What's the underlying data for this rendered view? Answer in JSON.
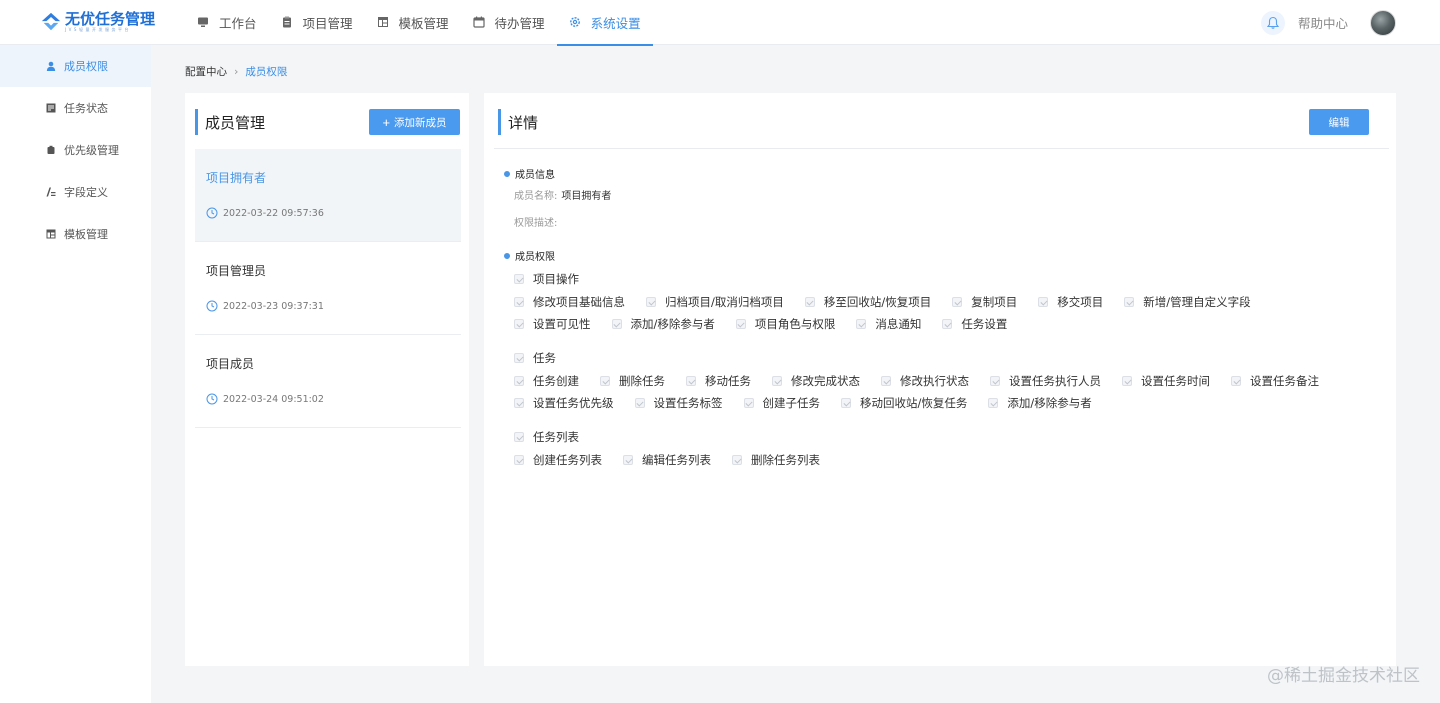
{
  "app": {
    "logo_title": "无优任务管理",
    "logo_subtitle": "JVS轻量开发服务平台"
  },
  "nav": [
    {
      "label": "工作台",
      "icon": "monitor-icon"
    },
    {
      "label": "项目管理",
      "icon": "clipboard-icon"
    },
    {
      "label": "模板管理",
      "icon": "template-icon"
    },
    {
      "label": "待办管理",
      "icon": "calendar-icon"
    },
    {
      "label": "系统设置",
      "icon": "gear-icon",
      "active": true
    }
  ],
  "header": {
    "help_label": "帮助中心"
  },
  "sidebar": {
    "items": [
      {
        "label": "成员权限",
        "icon": "user-icon",
        "active": true
      },
      {
        "label": "任务状态",
        "icon": "status-icon"
      },
      {
        "label": "优先级管理",
        "icon": "priority-icon"
      },
      {
        "label": "字段定义",
        "icon": "field-icon"
      },
      {
        "label": "模板管理",
        "icon": "template-icon"
      }
    ]
  },
  "breadcrumb": {
    "root": "配置中心",
    "current": "成员权限"
  },
  "members_panel": {
    "title": "成员管理",
    "add_button": "添加新成员",
    "members": [
      {
        "name": "项目拥有者",
        "time": "2022-03-22 09:57:36",
        "active": true
      },
      {
        "name": "项目管理员",
        "time": "2022-03-23 09:37:31"
      },
      {
        "name": "项目成员",
        "time": "2022-03-24 09:51:02"
      }
    ]
  },
  "details": {
    "title": "详情",
    "edit_button": "编辑",
    "info_section": "成员信息",
    "name_label": "成员名称:",
    "name_value": "项目拥有者",
    "desc_label": "权限描述:",
    "desc_value": "",
    "perm_section": "成员权限",
    "groups": [
      {
        "name": "项目操作",
        "rows": [
          [
            "修改项目基础信息",
            "归档项目/取消归档项目",
            "移至回收站/恢复项目",
            "复制项目",
            "移交项目",
            "新增/管理自定义字段"
          ],
          [
            "设置可见性",
            "添加/移除参与者",
            "项目角色与权限",
            "消息通知",
            "任务设置"
          ]
        ]
      },
      {
        "name": "任务",
        "rows": [
          [
            "任务创建",
            "删除任务",
            "移动任务",
            "修改完成状态",
            "修改执行状态",
            "设置任务执行人员",
            "设置任务时间",
            "设置任务备注"
          ],
          [
            "设置任务优先级",
            "设置任务标签",
            "创建子任务",
            "移动回收站/恢复任务",
            "添加/移除参与者"
          ]
        ]
      },
      {
        "name": "任务列表",
        "rows": [
          [
            "创建任务列表",
            "编辑任务列表",
            "删除任务列表"
          ]
        ]
      }
    ]
  },
  "watermark": "@稀土掘金技术社区",
  "colors": {
    "accent": "#3a8ee6",
    "button": "#4a9af0",
    "page_bg": "#f3f5f7"
  }
}
